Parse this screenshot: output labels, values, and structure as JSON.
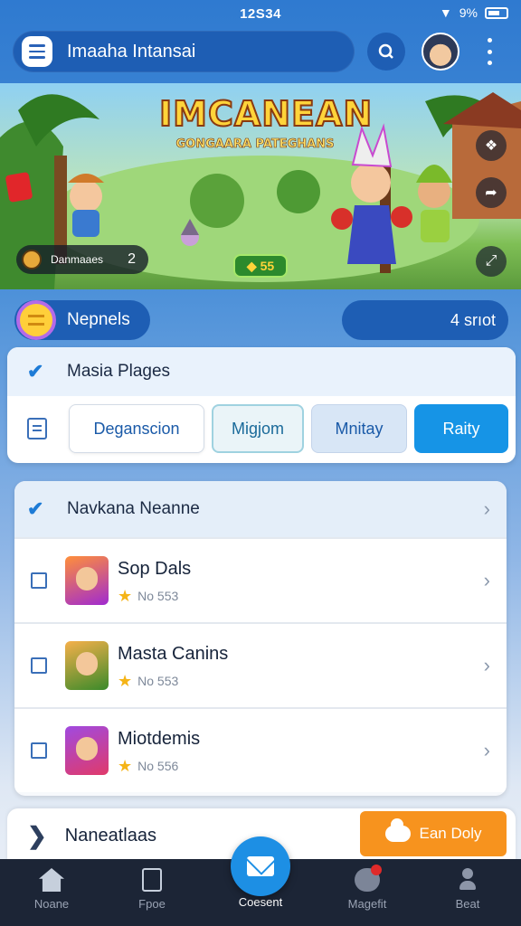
{
  "status_bar": {
    "time": "12S34",
    "battery": "9%"
  },
  "header": {
    "search_text": "Imaaha Intansai"
  },
  "banner": {
    "title": "IMCANEAN",
    "subtitle": "GONGAARA PATEGHANS",
    "chip_label": "Danmaaes",
    "chip_count": "2",
    "badge": "55"
  },
  "section": {
    "label": "Nepnels",
    "count": "4 srıot"
  },
  "pages_card": {
    "title": "Masia Plages",
    "tabs": [
      "Deganscion",
      "Migjom",
      "Mnitay",
      "Raity"
    ]
  },
  "list_card": {
    "title": "Navkana Neanne",
    "items": [
      {
        "name": "Sop Dals",
        "meta": "No 553"
      },
      {
        "name": "Masta Canins",
        "meta": "No 553"
      },
      {
        "name": "Miotdemis",
        "meta": "No 556"
      }
    ]
  },
  "news_card": {
    "title": "Naneatlaas",
    "button": "Ean Doly"
  },
  "nav": {
    "items": [
      "Noane",
      "Fpoe",
      "Coesent",
      "Magefit",
      "Beat"
    ]
  },
  "colors": {
    "primary": "#1e5eb4",
    "accent": "#1694e6",
    "orange": "#f7931e",
    "nav_bg": "#1c2536"
  }
}
